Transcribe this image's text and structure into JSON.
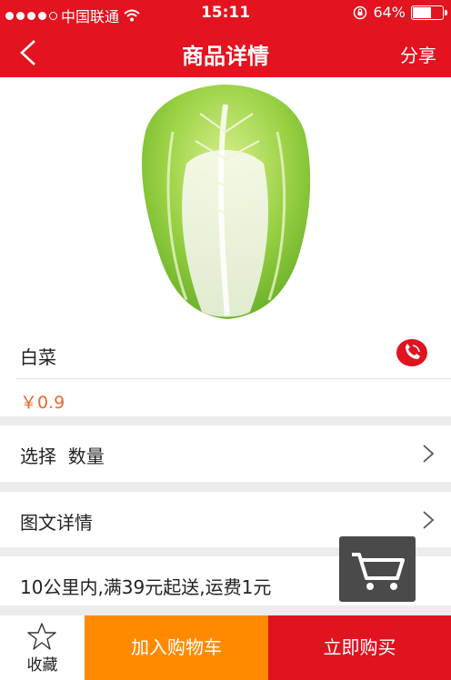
{
  "status_bar": {
    "carrier": "中国联通",
    "time": "15:11",
    "battery": "64%",
    "battery_level": 0.64
  },
  "nav": {
    "title": "商品详情",
    "share_label": "分享"
  },
  "product": {
    "name": "白菜",
    "price": "￥0.9"
  },
  "rows": {
    "select_label": "选择  数量",
    "detail_label": "图文详情",
    "delivery_note": "10公里内,满39元起送,运费1元"
  },
  "bottom_bar": {
    "favorite_label": "收藏",
    "add_to_cart_label": "加入购物车",
    "buy_now_label": "立即购买"
  },
  "colors": {
    "header": "#e3131f",
    "price": "#e8692c",
    "add_to_cart": "#ff8a00",
    "buy_now": "#e0131f"
  }
}
